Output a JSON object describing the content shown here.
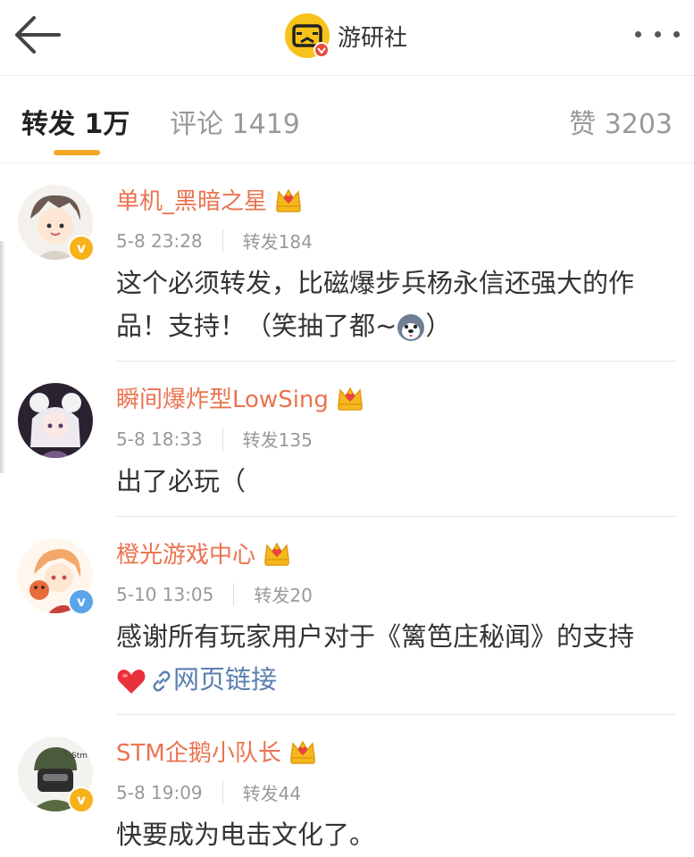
{
  "header": {
    "title": "游研社",
    "icons": {
      "back": "back-arrow-icon",
      "logo": "youyanshe-logo-icon",
      "more": "more-dots-icon"
    }
  },
  "tabs": {
    "repost": "转发 1万",
    "comment": "评论 1419",
    "like": "赞 3203",
    "active": "repost",
    "accent_color": "#f5a623"
  },
  "items": [
    {
      "name": "单机_黑暗之星",
      "time": "5-8 23:28",
      "reposts": "转发184",
      "content_text": "这个必须转发，比磁爆步兵杨永信还强大的作品！支持！（笑抽了都~",
      "content_tail": "）",
      "emoji": "husky-emoji-icon"
    },
    {
      "name": "瞬间爆炸型LowSing",
      "time": "5-8 18:33",
      "reposts": "转发135",
      "content_text": "出了必玩（"
    },
    {
      "name": "橙光游戏中心",
      "time": "5-10 13:05",
      "reposts": "转发20",
      "content_text": "感谢所有玩家用户对于《篱笆庄秘闻》的支持",
      "link_text": "网页链接",
      "emoji": "heart-icon"
    },
    {
      "name": "STM企鹅小队长",
      "time": "5-8 19:09",
      "reposts": "转发44",
      "content_text": "快要成为电击文化了。"
    }
  ],
  "colors": {
    "name": "#eb7350",
    "meta": "#999999",
    "link": "#5a7fb0",
    "verified_badge": "#f6b21b"
  }
}
